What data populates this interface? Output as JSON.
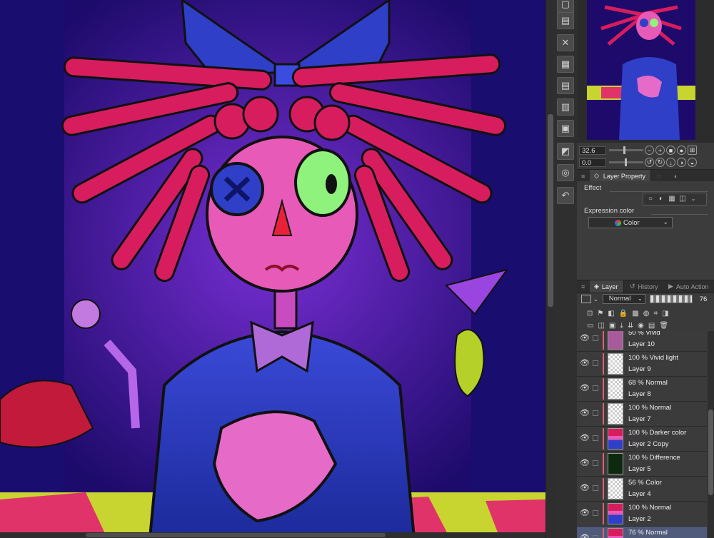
{
  "navigator": {
    "zoom_value": "32.6",
    "rotation_value": "0.0",
    "zoom_level": 0.45,
    "rotation_level": 0.48
  },
  "command_bar": {
    "icons": [
      "new-file-icon",
      "open-file-icon",
      "close-file-icon",
      "save-file-icon",
      "save-as-icon",
      "export-icon",
      "print-icon",
      "export-image-icon",
      "settings-icon",
      "undo-redo-icon"
    ]
  },
  "property_panel": {
    "tabs": {
      "layer_property": "Layer Property"
    },
    "effect_label": "Effect",
    "expression_color_label": "Expression color",
    "expression_color_value": "Color"
  },
  "layer_panel": {
    "tabs": {
      "layer": "Layer",
      "history": "History",
      "auto_action": "Auto Action"
    },
    "blend_mode": "Normal",
    "opacity": "76",
    "layers": [
      {
        "mode": "50 % Vivid",
        "name": "Layer 10",
        "thumb": "#a85a9a"
      },
      {
        "mode": "100 % Vivid light",
        "name": "Layer 9",
        "thumb": "checker"
      },
      {
        "mode": "68 % Normal",
        "name": "Layer 8",
        "thumb": "checker"
      },
      {
        "mode": "100 % Normal",
        "name": "Layer 7",
        "thumb": "checker"
      },
      {
        "mode": "100 % Darker color",
        "name": "Layer 2 Copy",
        "thumb": "art"
      },
      {
        "mode": "100 % Difference",
        "name": "Layer 5",
        "thumb": "#0e2a0e"
      },
      {
        "mode": "56 % Color",
        "name": "Layer 4",
        "thumb": "checker"
      },
      {
        "mode": "100 % Normal",
        "name": "Layer 2",
        "thumb": "art"
      },
      {
        "mode": "76 % Normal",
        "name": "",
        "thumb": "art"
      }
    ]
  },
  "colors": {
    "panel_bg": "#3a3a3a",
    "selected_layer": "#505a7a",
    "hair": "#d81d5e",
    "bow": "#2f3fc8",
    "skin": "#e85ab8"
  }
}
